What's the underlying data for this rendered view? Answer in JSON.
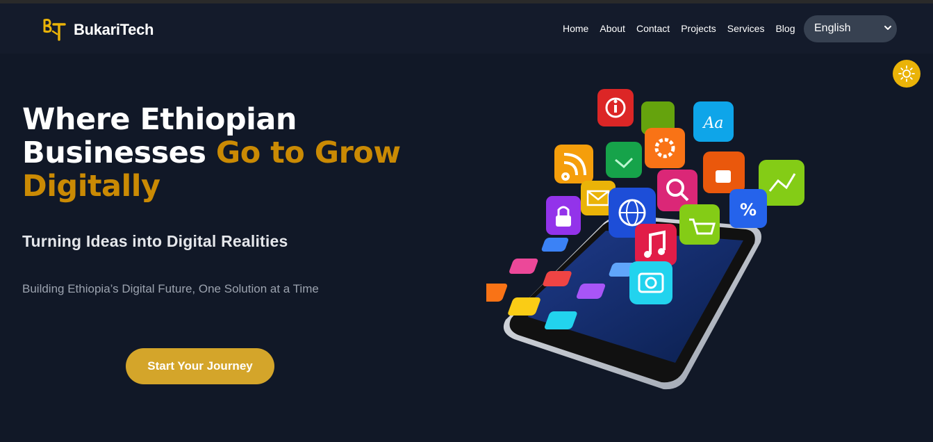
{
  "brand": {
    "name": "BukariTech",
    "logo_letters": "BT"
  },
  "nav": {
    "links": [
      "Home",
      "About",
      "Contact",
      "Projects",
      "Services",
      "Blog"
    ],
    "language": "English"
  },
  "hero": {
    "title_part1": "Where Ethiopian Businesses ",
    "title_accent": "Go to Grow Digitally",
    "subtitle": "Turning Ideas into Digital Realities",
    "tagline": "Building Ethiopia’s Digital Future, One Solution at a Time",
    "cta_label": "Start Your Journey"
  },
  "colors": {
    "background": "#111827",
    "navbar": "#141b2b",
    "accent": "#ca8a04",
    "cta": "#d4a52a",
    "toggle": "#eab308"
  },
  "icons": [
    "logo-icon",
    "chevron-down-icon",
    "sun-icon",
    "phone-apps-illustration"
  ]
}
